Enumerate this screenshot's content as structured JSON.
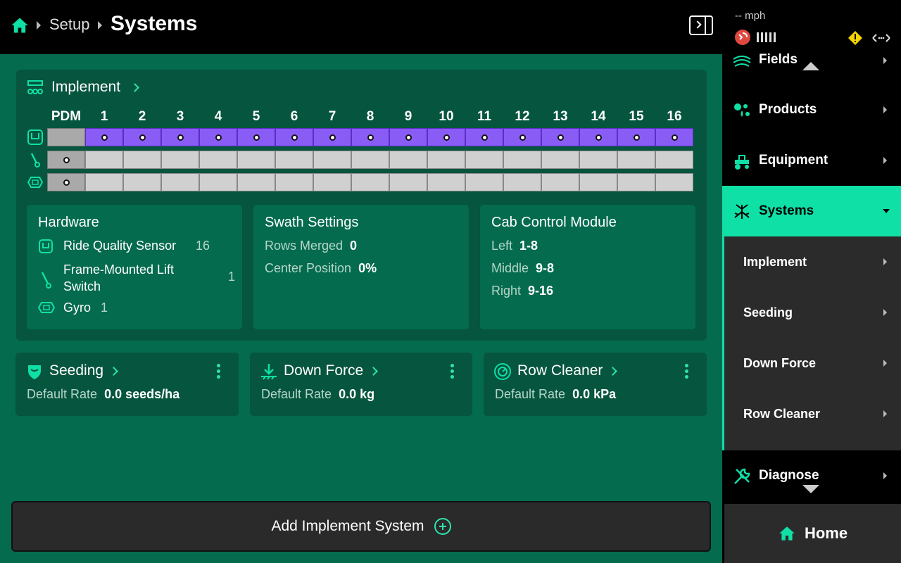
{
  "breadcrumb": {
    "setup": "Setup",
    "title": "Systems"
  },
  "status": {
    "speed": "-- mph"
  },
  "implement": {
    "title": "Implement",
    "pdm_label": "PDM",
    "columns": [
      "1",
      "2",
      "3",
      "4",
      "5",
      "6",
      "7",
      "8",
      "9",
      "10",
      "11",
      "12",
      "13",
      "14",
      "15",
      "16"
    ],
    "rows": [
      {
        "icon": "ride-quality-sensor-icon",
        "pdm_dot": false,
        "row_dots": true,
        "row_color": "#8a5cf6"
      },
      {
        "icon": "lift-switch-icon",
        "pdm_dot": true,
        "row_dots": false,
        "row_color": "#d0d0d0"
      },
      {
        "icon": "gyro-icon",
        "pdm_dot": true,
        "row_dots": false,
        "row_color": "#d0d0d0"
      }
    ]
  },
  "hardware": {
    "title": "Hardware",
    "items": [
      {
        "name": "Ride Quality Sensor",
        "count": "16"
      },
      {
        "name": "Frame-Mounted Lift Switch",
        "count": "1"
      },
      {
        "name": "Gyro",
        "count": "1"
      }
    ]
  },
  "swath": {
    "title": "Swath Settings",
    "rows_merged_label": "Rows Merged",
    "rows_merged": "0",
    "center_label": "Center Position",
    "center": "0%"
  },
  "cab": {
    "title": "Cab Control Module",
    "left_label": "Left",
    "left": "1-8",
    "middle_label": "Middle",
    "middle": "9-8",
    "right_label": "Right",
    "right": "9-16"
  },
  "systems": [
    {
      "title": "Seeding",
      "rate_label": "Default Rate",
      "rate": "0.0 seeds/ha"
    },
    {
      "title": "Down Force",
      "rate_label": "Default Rate",
      "rate": "0.0 kg"
    },
    {
      "title": "Row Cleaner",
      "rate_label": "Default Rate",
      "rate": "0.0 kPa"
    }
  ],
  "add_button": "Add Implement System",
  "sidebar": {
    "items": [
      {
        "label": "Fields"
      },
      {
        "label": "Products"
      },
      {
        "label": "Equipment"
      },
      {
        "label": "Systems"
      }
    ],
    "sub_items": [
      {
        "label": "Implement"
      },
      {
        "label": "Seeding"
      },
      {
        "label": "Down Force"
      },
      {
        "label": "Row Cleaner"
      }
    ],
    "diagnose": "Diagnose",
    "home": "Home"
  },
  "colors": {
    "accent": "#0fe0a6",
    "background": "#046b4e",
    "card": "#06553e",
    "purple": "#8a5cf6"
  }
}
